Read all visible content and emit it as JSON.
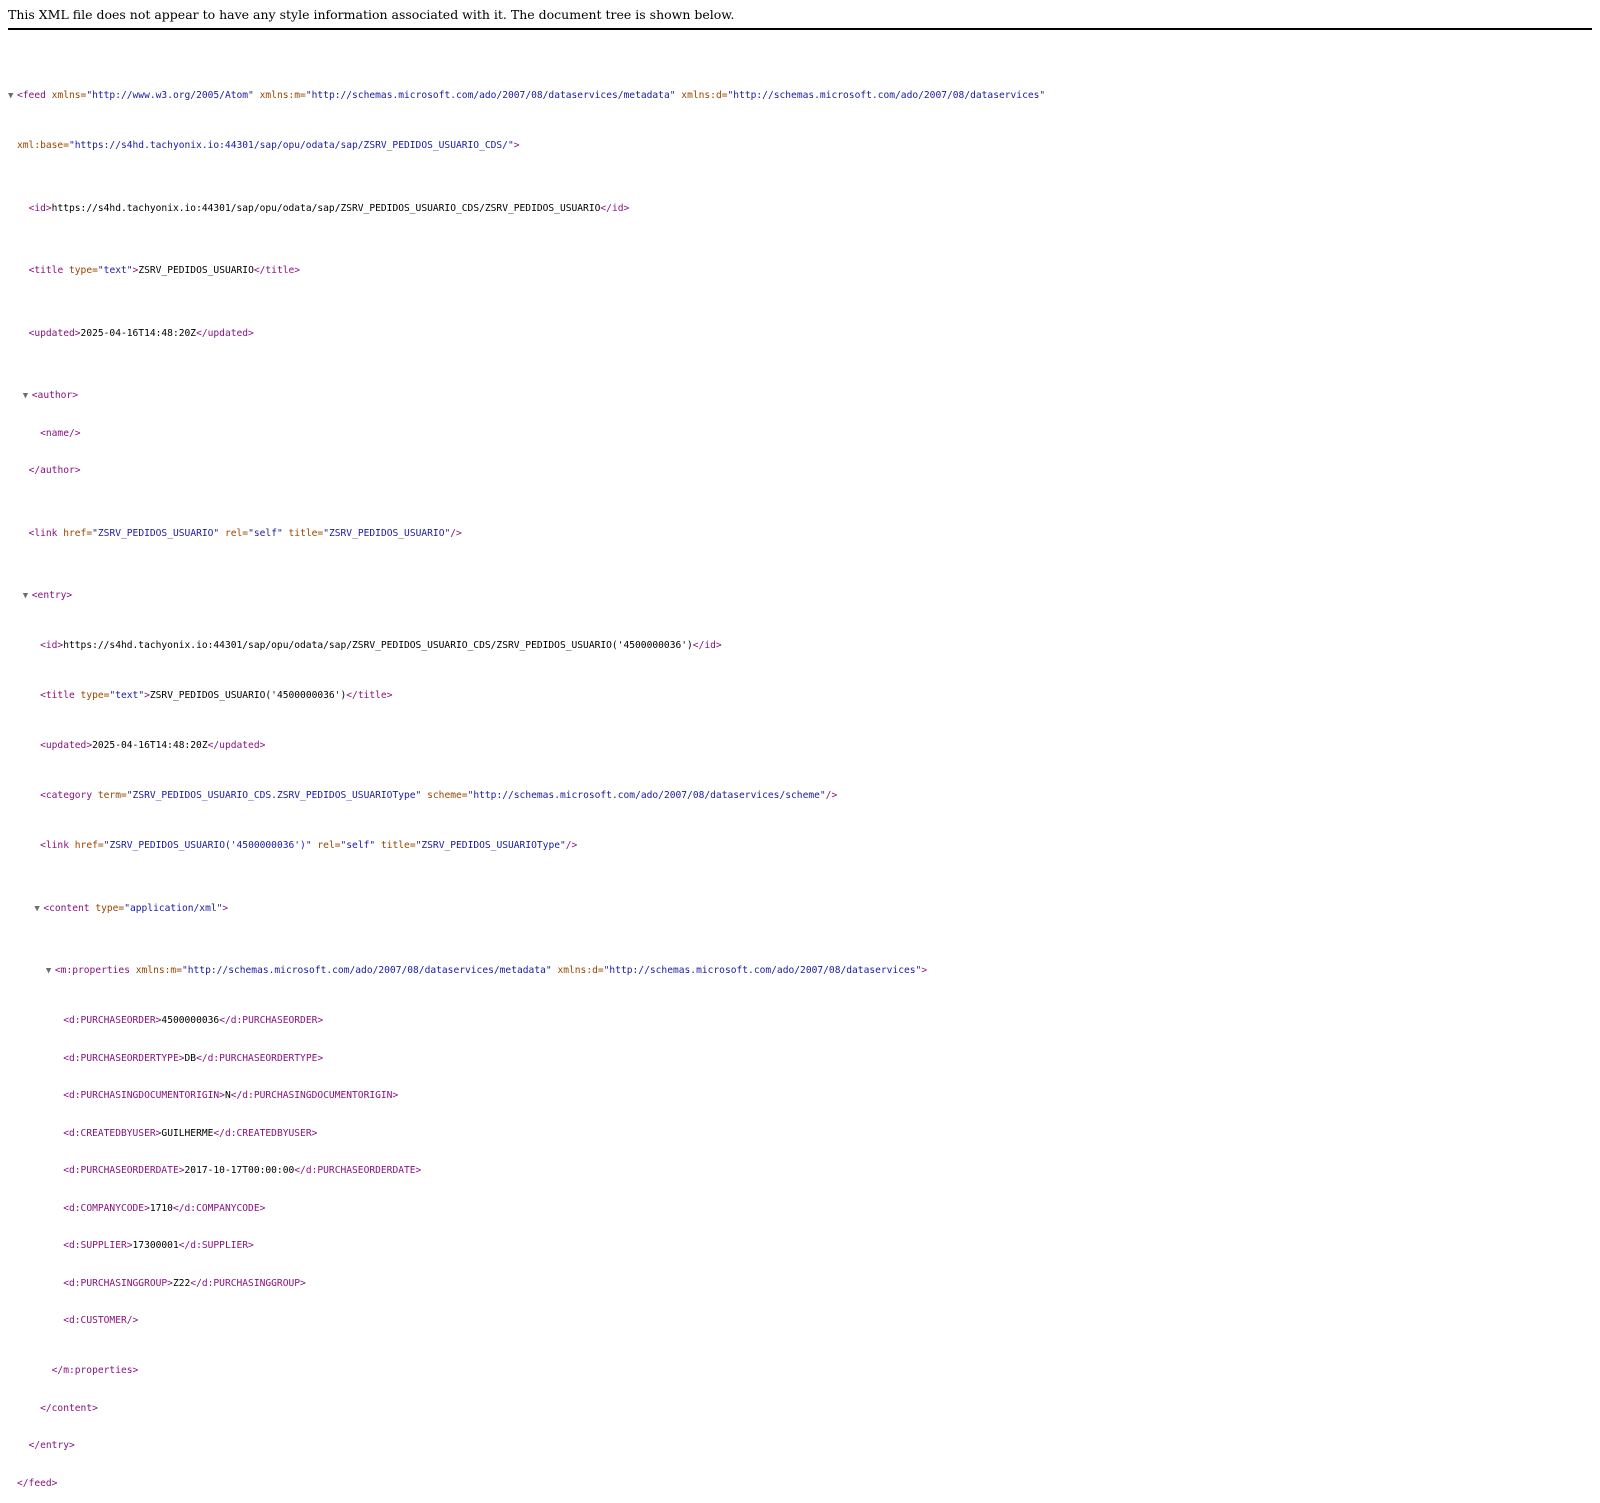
{
  "notice": "This XML file does not appear to have any style information associated with it. The document tree is shown below.",
  "toggle_glyph": "▼",
  "feed": {
    "open": "<feed",
    "xmlns_attr": "xmlns=",
    "xmlns_val": "\"http://www.w3.org/2005/Atom\"",
    "xmlns_m_attr": "xmlns:m=",
    "xmlns_m_val": "\"http://schemas.microsoft.com/ado/2007/08/dataservices/metadata\"",
    "xmlns_d_attr": "xmlns:d=",
    "xmlns_d_val": "\"http://schemas.microsoft.com/ado/2007/08/dataservices\"",
    "xmlbase_attr": "xml:base=",
    "xmlbase_val": "\"https://s4hd.tachyonix.io:44301/sap/opu/odata/sap/ZSRV_PEDIDOS_USUARIO_CDS/\"",
    "gt": ">",
    "close": "</feed>"
  },
  "id": {
    "open": "<id>",
    "value": "https://s4hd.tachyonix.io:44301/sap/opu/odata/sap/ZSRV_PEDIDOS_USUARIO_CDS/ZSRV_PEDIDOS_USUARIO",
    "close": "</id>"
  },
  "title": {
    "open": "<title",
    "type_attr": "type=",
    "type_val": "\"text\"",
    "gt": ">",
    "value": "ZSRV_PEDIDOS_USUARIO",
    "close": "</title>"
  },
  "updated": {
    "open": "<updated>",
    "value": "2025-04-16T14:48:20Z",
    "close": "</updated>"
  },
  "author": {
    "open": "<author>",
    "name": "<name/>",
    "close": "</author>"
  },
  "link": {
    "open": "<link",
    "href_attr": "href=",
    "href_val": "\"ZSRV_PEDIDOS_USUARIO\"",
    "rel_attr": "rel=",
    "rel_val": "\"self\"",
    "title_attr": "title=",
    "title_val": "\"ZSRV_PEDIDOS_USUARIO\"",
    "end": "/>"
  },
  "entry": {
    "open": "<entry>",
    "close": "</entry>",
    "id_open": "<id>",
    "id_value": "https://s4hd.tachyonix.io:44301/sap/opu/odata/sap/ZSRV_PEDIDOS_USUARIO_CDS/ZSRV_PEDIDOS_USUARIO('4500000036')",
    "id_close": "</id>",
    "title_open": "<title",
    "title_type_attr": "type=",
    "title_type_val": "\"text\"",
    "title_gt": ">",
    "title_value": "ZSRV_PEDIDOS_USUARIO('4500000036')",
    "title_close": "</title>",
    "updated_open": "<updated>",
    "updated_value": "2025-04-16T14:48:20Z",
    "updated_close": "</updated>",
    "category_open": "<category",
    "category_term_attr": "term=",
    "category_term_val": "\"ZSRV_PEDIDOS_USUARIO_CDS.ZSRV_PEDIDOS_USUARIOType\"",
    "category_scheme_attr": "scheme=",
    "category_scheme_val": "\"http://schemas.microsoft.com/ado/2007/08/dataservices/scheme\"",
    "category_end": "/>",
    "link_open": "<link",
    "link_href_attr": "href=",
    "link_href_val": "\"ZSRV_PEDIDOS_USUARIO('4500000036')\"",
    "link_rel_attr": "rel=",
    "link_rel_val": "\"self\"",
    "link_title_attr": "title=",
    "link_title_val": "\"ZSRV_PEDIDOS_USUARIOType\"",
    "link_end": "/>"
  },
  "content": {
    "open": "<content",
    "type_attr": "type=",
    "type_val": "\"application/xml\"",
    "gt": ">",
    "close": "</content>"
  },
  "properties": {
    "open": "<m:properties",
    "xmlns_m_attr": "xmlns:m=",
    "xmlns_m_val": "\"http://schemas.microsoft.com/ado/2007/08/dataservices/metadata\"",
    "xmlns_d_attr": "xmlns:d=",
    "xmlns_d_val": "\"http://schemas.microsoft.com/ado/2007/08/dataservices\"",
    "gt": ">",
    "close": "</m:properties>",
    "fields": [
      {
        "open": "<d:PURCHASEORDER>",
        "value": "4500000036",
        "close": "</d:PURCHASEORDER>"
      },
      {
        "open": "<d:PURCHASEORDERTYPE>",
        "value": "DB",
        "close": "</d:PURCHASEORDERTYPE>"
      },
      {
        "open": "<d:PURCHASINGDOCUMENTORIGIN>",
        "value": "N",
        "close": "</d:PURCHASINGDOCUMENTORIGIN>"
      },
      {
        "open": "<d:CREATEDBYUSER>",
        "value": "GUILHERME",
        "close": "</d:CREATEDBYUSER>"
      },
      {
        "open": "<d:PURCHASEORDERDATE>",
        "value": "2017-10-17T00:00:00",
        "close": "</d:PURCHASEORDERDATE>"
      },
      {
        "open": "<d:COMPANYCODE>",
        "value": "1710",
        "close": "</d:COMPANYCODE>"
      },
      {
        "open": "<d:SUPPLIER>",
        "value": "17300001",
        "close": "</d:SUPPLIER>"
      },
      {
        "open": "<d:PURCHASINGGROUP>",
        "value": "Z22",
        "close": "</d:PURCHASINGGROUP>"
      }
    ],
    "customer": "<d:CUSTOMER/>"
  },
  "colors": {
    "tag": "#881280",
    "attribute_name": "#994500",
    "attribute_value": "#1a1aa6",
    "text": "#000000"
  }
}
